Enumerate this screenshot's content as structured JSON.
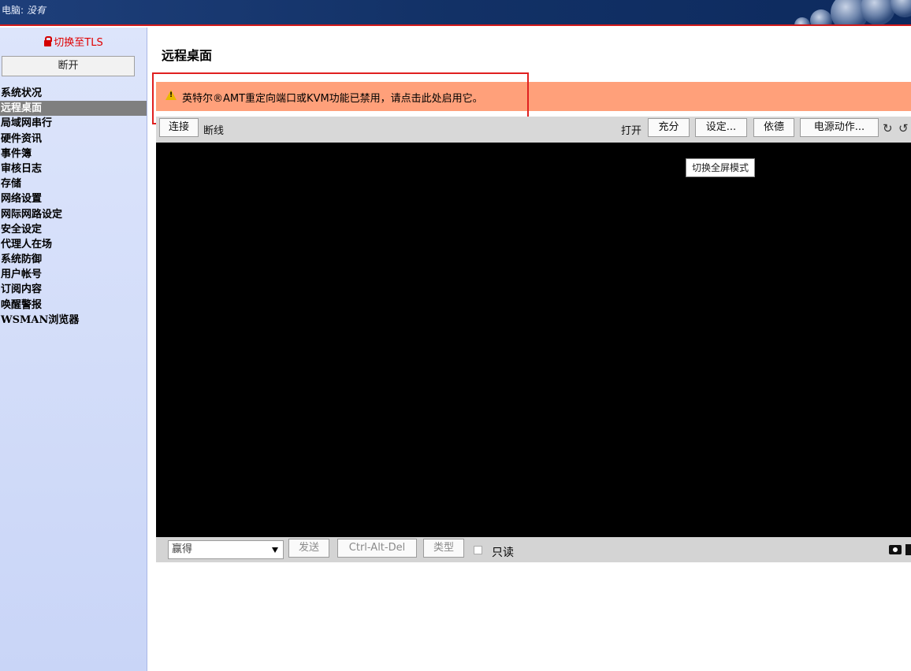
{
  "topbar": {
    "computer_label": "电脑: ",
    "computer_name": "没有"
  },
  "sidebar": {
    "tls_label": "切换至TLS",
    "disconnect_label": "断开",
    "items": [
      {
        "label": "系统状况",
        "active": false
      },
      {
        "label": "远程桌面",
        "active": true
      },
      {
        "label": "局域网串行",
        "active": false
      },
      {
        "label": "硬件资讯",
        "active": false
      },
      {
        "label": "事件簿",
        "active": false
      },
      {
        "label": "审核日志",
        "active": false
      },
      {
        "label": "存储",
        "active": false
      },
      {
        "label": "网络设置",
        "active": false
      },
      {
        "label": "网际网路设定",
        "active": false
      },
      {
        "label": "安全设定",
        "active": false
      },
      {
        "label": "代理人在场",
        "active": false
      },
      {
        "label": "系统防御",
        "active": false
      },
      {
        "label": "用户帐号",
        "active": false
      },
      {
        "label": "订阅内容",
        "active": false
      },
      {
        "label": "唤醒警报",
        "active": false
      },
      {
        "label": "WSMAN浏览器",
        "active": false
      }
    ]
  },
  "main": {
    "title": "远程桌面",
    "warning_text": "英特尔®AMT重定向端口或KVM功能已禁用，请点击此处启用它。",
    "toolbar": {
      "connect_label": "连接",
      "disconnect_label": "断线",
      "open_label": "打开",
      "fill_label": "充分",
      "settings_label": "设定...",
      "depend_label": "依德",
      "power_label": "电源动作...",
      "rotate_left": "↻",
      "rotate_right": "↺"
    },
    "tooltip": "切换全屏模式",
    "bottombar": {
      "select_value": "赢得",
      "send_label": "发送",
      "cad_label": "Ctrl-Alt-Del",
      "type_label": "类型",
      "readonly_label": "只读"
    }
  },
  "colors": {
    "warning_bg": "#ffa07a",
    "active_nav": "#7f7f7f",
    "tls_red": "#e00000"
  }
}
